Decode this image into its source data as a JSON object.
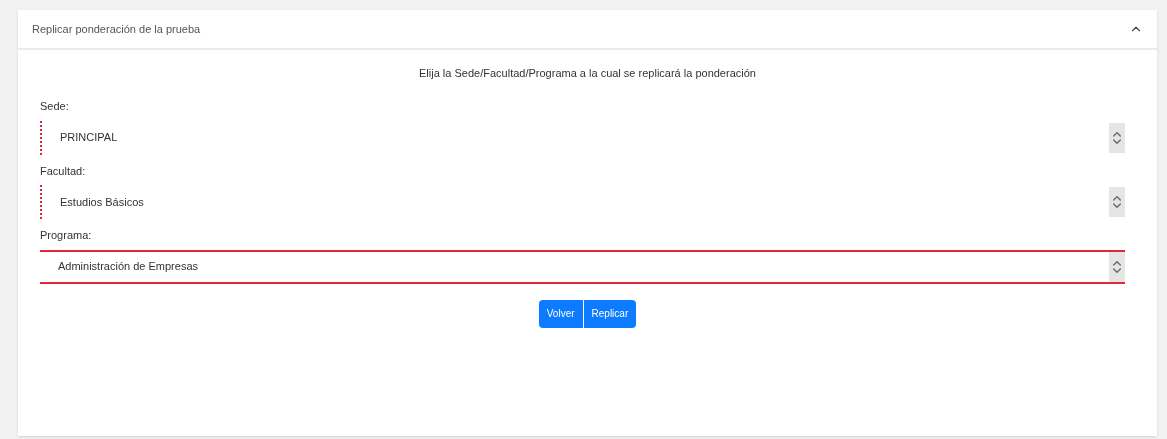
{
  "panel": {
    "title": "Replicar ponderación de la prueba",
    "expanded": true
  },
  "instruction": "Elija la Sede/Facultad/Programa a la cual se replicará la ponderación",
  "fields": [
    {
      "label": "Sede:",
      "value": "PRINCIPAL",
      "invalid": false
    },
    {
      "label": "Facultad:",
      "value": "Estudios Básicos",
      "invalid": false
    },
    {
      "label": "Programa:",
      "value": "Administración de Empresas",
      "invalid": true
    }
  ],
  "buttons": [
    "Volver",
    "Replicar"
  ]
}
